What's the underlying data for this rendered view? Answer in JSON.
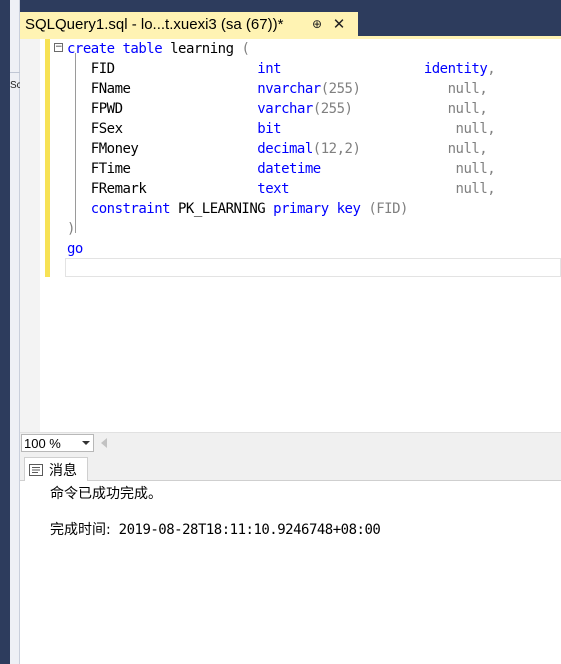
{
  "tab": {
    "title": "SQLQuery1.sql - lo...t.xuexi3 (sa (67))*",
    "pin_glyph": "⊕",
    "close_glyph": "✕"
  },
  "left_pane": {
    "fragment": "Sc"
  },
  "editor": {
    "lines": [
      {
        "parts": [
          {
            "t": "create table",
            "c": "kw"
          },
          {
            "t": " learning ",
            "c": ""
          },
          {
            "t": "(",
            "c": "gr"
          }
        ]
      },
      {
        "parts": [
          {
            "t": "   FID",
            "c": ""
          },
          {
            "t": "                  int",
            "c": "kw"
          },
          {
            "t": "                  ",
            "c": ""
          },
          {
            "t": "identity",
            "c": "kw"
          },
          {
            "t": ",",
            "c": "gr"
          }
        ]
      },
      {
        "parts": [
          {
            "t": "   FName",
            "c": ""
          },
          {
            "t": "                nvarchar",
            "c": "kw"
          },
          {
            "t": "(255)",
            "c": "gr"
          },
          {
            "t": "           ",
            "c": ""
          },
          {
            "t": "null,",
            "c": "gr"
          }
        ]
      },
      {
        "parts": [
          {
            "t": "   FPWD",
            "c": ""
          },
          {
            "t": "                 varchar",
            "c": "kw"
          },
          {
            "t": "(255)",
            "c": "gr"
          },
          {
            "t": "            ",
            "c": ""
          },
          {
            "t": "null,",
            "c": "gr"
          }
        ]
      },
      {
        "parts": [
          {
            "t": "   FSex",
            "c": ""
          },
          {
            "t": "                 bit",
            "c": "kw"
          },
          {
            "t": "                      ",
            "c": ""
          },
          {
            "t": "null,",
            "c": "gr"
          }
        ]
      },
      {
        "parts": [
          {
            "t": "   FMoney",
            "c": ""
          },
          {
            "t": "               decimal",
            "c": "kw"
          },
          {
            "t": "(12,2)",
            "c": "gr"
          },
          {
            "t": "           ",
            "c": ""
          },
          {
            "t": "null,",
            "c": "gr"
          }
        ]
      },
      {
        "parts": [
          {
            "t": "   FTime",
            "c": ""
          },
          {
            "t": "                datetime",
            "c": "kw"
          },
          {
            "t": "                 ",
            "c": ""
          },
          {
            "t": "null,",
            "c": "gr"
          }
        ]
      },
      {
        "parts": [
          {
            "t": "   FRemark",
            "c": ""
          },
          {
            "t": "              text",
            "c": "kw"
          },
          {
            "t": "                     ",
            "c": ""
          },
          {
            "t": "null,",
            "c": "gr"
          }
        ]
      },
      {
        "parts": [
          {
            "t": "   constraint",
            "c": "kw"
          },
          {
            "t": " PK_LEARNING ",
            "c": ""
          },
          {
            "t": "primary key",
            "c": "kw"
          },
          {
            "t": " ",
            "c": ""
          },
          {
            "t": "(FID)",
            "c": "gr"
          }
        ]
      },
      {
        "parts": [
          {
            "t": ")",
            "c": "gr"
          }
        ]
      },
      {
        "parts": [
          {
            "t": "go",
            "c": "kw"
          }
        ]
      }
    ]
  },
  "zoom": {
    "value": "100 %"
  },
  "results": {
    "tab_label": "消息",
    "message": "命令已成功完成。",
    "completion_label": "完成时间:",
    "completion_time": "2019-08-28T18:11:10.9246748+08:00"
  },
  "colors": {
    "tab_active": "#fff3b3",
    "keyword": "#0000ff",
    "chrome_dark": "#2d3c5d",
    "change_bar": "#f7e255"
  }
}
